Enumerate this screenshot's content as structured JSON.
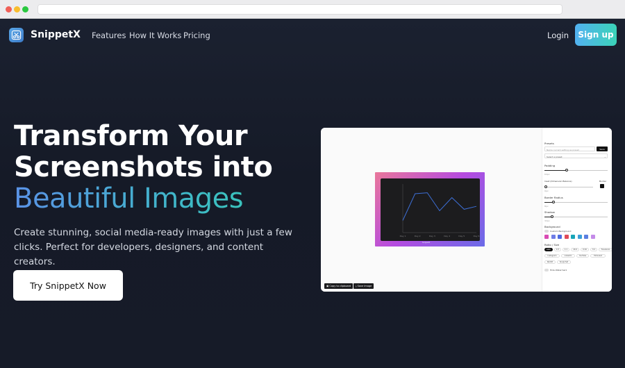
{
  "nav": {
    "brand": "SnippetX",
    "links": [
      "Features",
      "How It Works",
      "Pricing"
    ],
    "login": "Login",
    "signup": "Sign up"
  },
  "hero": {
    "title_line1": "Transform Your",
    "title_line2": "Screenshots into",
    "title_line3": "Beautiful Images",
    "subtitle": "Create stunning, social media-ready images with just a few clicks. Perfect for developers, designers, and content creators.",
    "cta": "Try SnippetX Now"
  },
  "preview": {
    "panel": {
      "presets_label": "Presets",
      "preset_placeholder": "Name current setting as preset",
      "save_label": "Save",
      "select_label": "Select a preset",
      "padding_label": "Padding",
      "padding_value": "64px",
      "inset_label": "Inset (Dimension Balance)",
      "border_label": "Border",
      "inset_value": "0px",
      "radius_label": "Border Radius",
      "radius_value": "8px",
      "shadow_label": "Shadow",
      "shadow_value": "32px",
      "background_label": "Background",
      "custom_bg_label": "Custom Background",
      "ratio_label": "Ratio / Size",
      "ratio_row1": [
        "Auto",
        "4:3",
        "1:1",
        "16:9",
        "9:16",
        "3:2",
        "Facebook"
      ],
      "ratio_row2": [
        "Instagram",
        "LinkedIn",
        "YouTube",
        "Pinterest"
      ],
      "ratio_row3": [
        "Reddit",
        "Snapchat"
      ],
      "hide_watermark": "Hide Watermark"
    },
    "copy_button": "Copy to clipboard",
    "save_button": "Save Image",
    "caption": "SnippetX",
    "chart_data": {
      "type": "line",
      "categories": [
        "Day 1",
        "Day 2",
        "Day 3",
        "Day 4",
        "Day 5",
        "Day 6"
      ],
      "values": [
        25,
        80,
        82,
        45,
        72,
        48,
        54
      ],
      "ylim": [
        0,
        100
      ]
    },
    "swatch_colors": [
      "#d94bb4",
      "#6f7de6",
      "#4d6be0",
      "#e04b59",
      "#18a5b8",
      "#3c9ed8",
      "#5b7fe0",
      "#c48be8"
    ]
  },
  "colors": {
    "accent_start": "#52b1f0",
    "accent_end": "#3bd3b8",
    "background": "#171c29"
  }
}
